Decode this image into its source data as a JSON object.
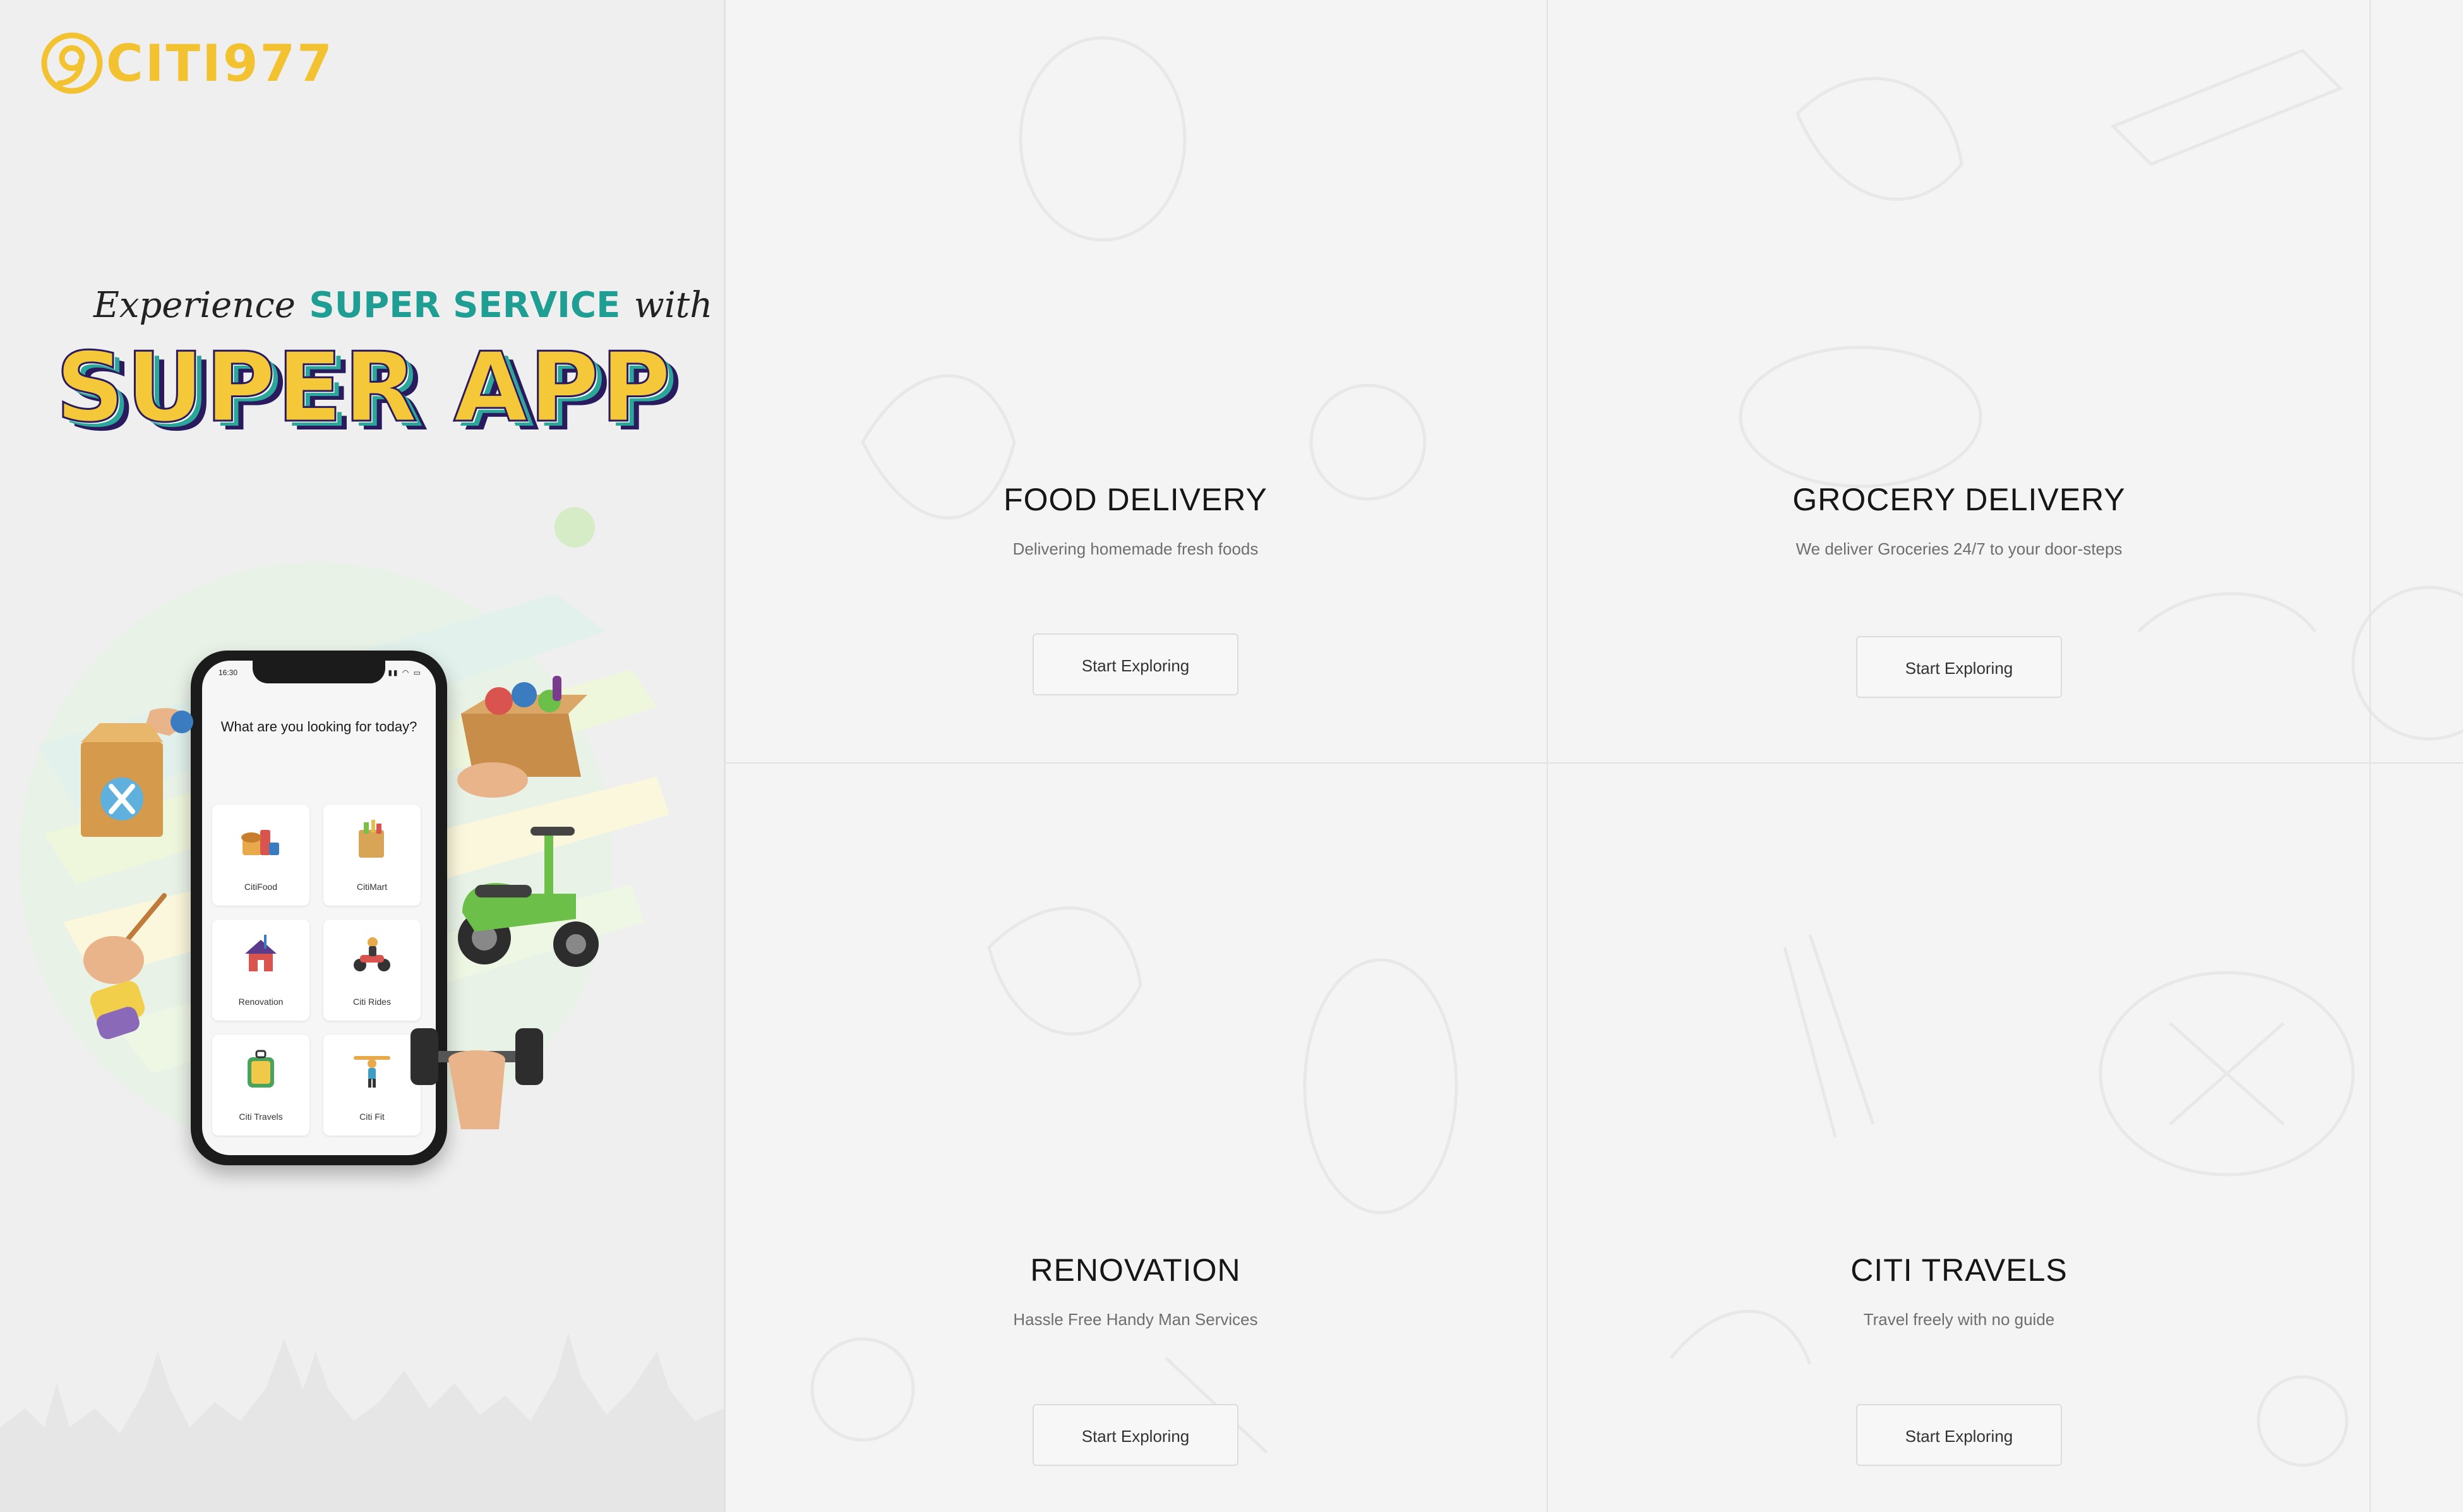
{
  "brand": {
    "name": "CITI977",
    "color": "#f2c230"
  },
  "hero": {
    "line1_script_a": "Experience",
    "line1_highlight": "SUPER SERVICE",
    "line1_script_b": "with our",
    "headline": "SUPER APP"
  },
  "phone": {
    "status_time": "16:30",
    "question": "What are you looking for today?",
    "tiles": [
      {
        "label": "CitiFood",
        "icon": "food-icon"
      },
      {
        "label": "CitiMart",
        "icon": "grocery-bag-icon"
      },
      {
        "label": "Renovation",
        "icon": "house-tools-icon"
      },
      {
        "label": "Citi Rides",
        "icon": "scooter-rider-icon"
      },
      {
        "label": "Citi Travels",
        "icon": "luggage-icon"
      },
      {
        "label": "Citi Fit",
        "icon": "fitness-icon"
      }
    ]
  },
  "services": [
    {
      "title": "FOOD DELIVERY",
      "description": "Delivering homemade fresh foods",
      "button": "Start Exploring"
    },
    {
      "title": "GROCERY DELIVERY",
      "description": "We deliver Groceries 24/7 to your door-steps",
      "button": "Start Exploring"
    },
    {
      "title": "RENOVATION",
      "description": "Hassle Free Handy Man Services",
      "button": "Start Exploring"
    },
    {
      "title": "CITI TRAVELS",
      "description": "Travel freely with no guide",
      "button": "Start Exploring"
    }
  ],
  "colors": {
    "accent_yellow": "#f5c83a",
    "accent_teal": "#1f9e94",
    "accent_purple": "#2a1a5e",
    "scooter_green": "#6cc04a"
  }
}
